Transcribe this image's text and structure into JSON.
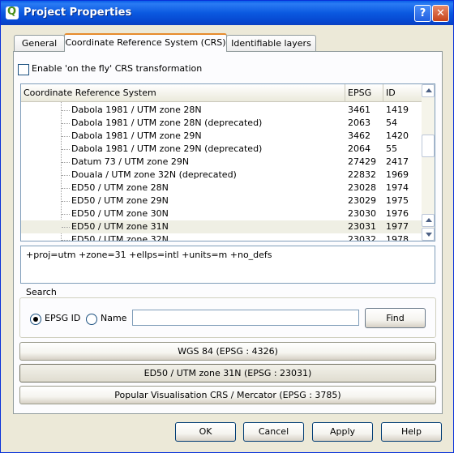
{
  "window": {
    "title": "Project Properties",
    "help_label": "?",
    "close_label": "✕"
  },
  "tabs": [
    "General",
    "Coordinate Reference System (CRS)",
    "Identifiable layers"
  ],
  "otf_label": "Enable 'on the fly' CRS transformation",
  "tree": {
    "headers": [
      "Coordinate Reference System",
      "EPSG",
      "ID"
    ],
    "rows": [
      {
        "name": "Dabola 1981 / UTM zone 28N",
        "epsg": "3461",
        "id": "1419"
      },
      {
        "name": "Dabola 1981 / UTM zone 28N (deprecated)",
        "epsg": "2063",
        "id": "54"
      },
      {
        "name": "Dabola 1981 / UTM zone 29N",
        "epsg": "3462",
        "id": "1420"
      },
      {
        "name": "Dabola 1981 / UTM zone 29N (deprecated)",
        "epsg": "2064",
        "id": "55"
      },
      {
        "name": "Datum 73 / UTM zone 29N",
        "epsg": "27429",
        "id": "2417"
      },
      {
        "name": "Douala / UTM zone 32N (deprecated)",
        "epsg": "22832",
        "id": "1969"
      },
      {
        "name": "ED50 / UTM zone 28N",
        "epsg": "23028",
        "id": "1974"
      },
      {
        "name": "ED50 / UTM zone 29N",
        "epsg": "23029",
        "id": "1975"
      },
      {
        "name": "ED50 / UTM zone 30N",
        "epsg": "23030",
        "id": "1976"
      },
      {
        "name": "ED50 / UTM zone 31N",
        "epsg": "23031",
        "id": "1977"
      },
      {
        "name": "ED50 / UTM zone 32N",
        "epsg": "23032",
        "id": "1978"
      }
    ],
    "selected_index": 9
  },
  "proj_string": "+proj=utm +zone=31 +ellps=intl +units=m +no_defs",
  "search": {
    "title": "Search",
    "epsg_label": "EPSG ID",
    "name_label": "Name",
    "value": "",
    "find_label": "Find"
  },
  "recent": [
    "WGS 84 (EPSG : 4326)",
    "ED50 / UTM zone 31N (EPSG : 23031)",
    "Popular Visualisation CRS / Mercator (EPSG : 3785)"
  ],
  "buttons": {
    "ok": "OK",
    "cancel": "Cancel",
    "apply": "Apply",
    "help": "Help"
  }
}
